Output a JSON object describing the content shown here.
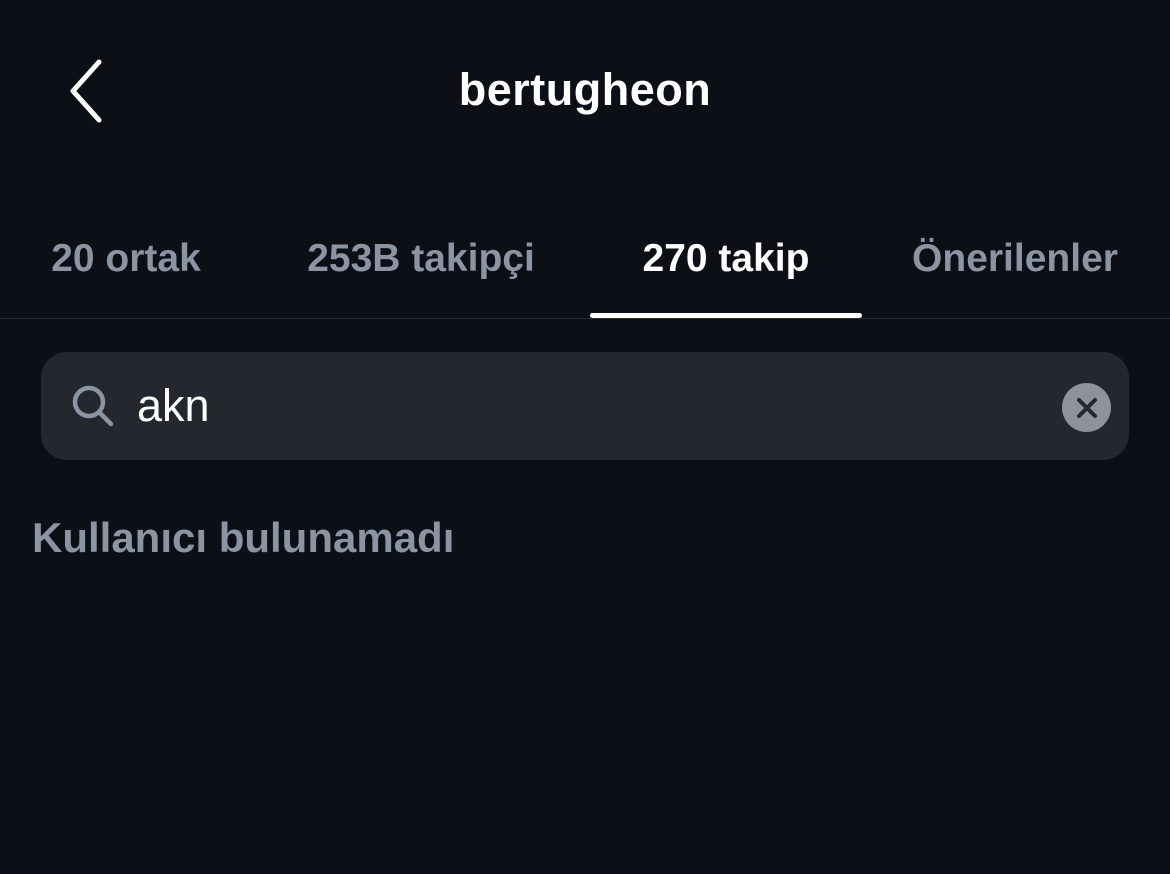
{
  "header": {
    "back_icon": "chevron-left-icon",
    "title": "bertugheon"
  },
  "tabs": [
    {
      "label": "20 ortak",
      "active": false
    },
    {
      "label": "253B takipçi",
      "active": false
    },
    {
      "label": "270 takip",
      "active": true
    },
    {
      "label": "Önerilenler",
      "active": false
    }
  ],
  "search": {
    "icon": "search-icon",
    "value": "akn",
    "clear_icon": "close-circle-icon"
  },
  "empty_state": {
    "message": "Kullanıcı bulunamadı"
  },
  "colors": {
    "background": "#0c0f15",
    "search_field": "#24272e",
    "muted_text": "#8b94a3",
    "active_text": "#ffffff"
  }
}
